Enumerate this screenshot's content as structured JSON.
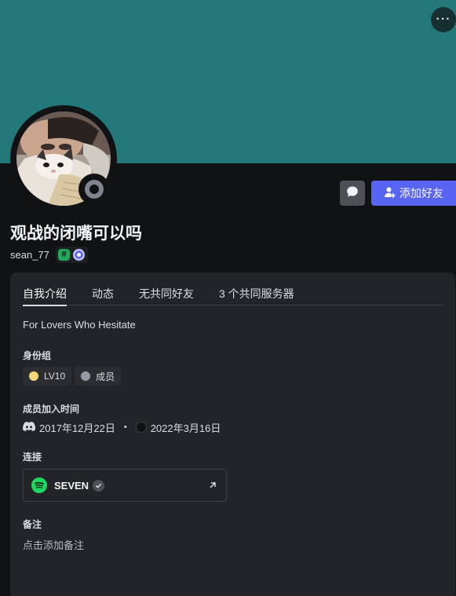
{
  "colors": {
    "banner": "#23797a",
    "accent": "#5865f2",
    "status_offline": "#80848e",
    "role_lv10": "#f5d67a",
    "role_member": "#949ba4",
    "spotify": "#1ed760"
  },
  "header": {
    "more_icon": "more-horizontal-icon",
    "more_label": "···"
  },
  "actions": {
    "message_icon": "chat-bubble-icon",
    "add_friend_icon": "add-person-icon",
    "add_friend_label": "添加好友"
  },
  "profile": {
    "display_name": "观战的闭嘴可以吗",
    "username": "sean_77",
    "status": "offline",
    "badges": [
      {
        "name": "hashtag-badge-icon",
        "glyph": "#"
      },
      {
        "name": "server-boost-badge-icon"
      }
    ]
  },
  "tabs": [
    {
      "label": "自我介绍",
      "active": true
    },
    {
      "label": "动态",
      "active": false
    },
    {
      "label": "无共同好友",
      "active": false
    },
    {
      "label": "3 个共同服务器",
      "active": false
    }
  ],
  "about": {
    "text": "For Lovers Who Hesitate"
  },
  "roles": {
    "title": "身份组",
    "items": [
      {
        "label": "LV10",
        "color": "#f5d67a"
      },
      {
        "label": "成员",
        "color": "#949ba4"
      }
    ]
  },
  "member_since": {
    "title": "成员加入时间",
    "discord_date": "2017年12月22日",
    "separator": "•",
    "server_date": "2022年3月16日"
  },
  "connections": {
    "title": "连接",
    "items": [
      {
        "service": "Spotify",
        "name": "SEVEN",
        "verified": true
      }
    ]
  },
  "note": {
    "title": "备注",
    "placeholder": "点击添加备注"
  }
}
